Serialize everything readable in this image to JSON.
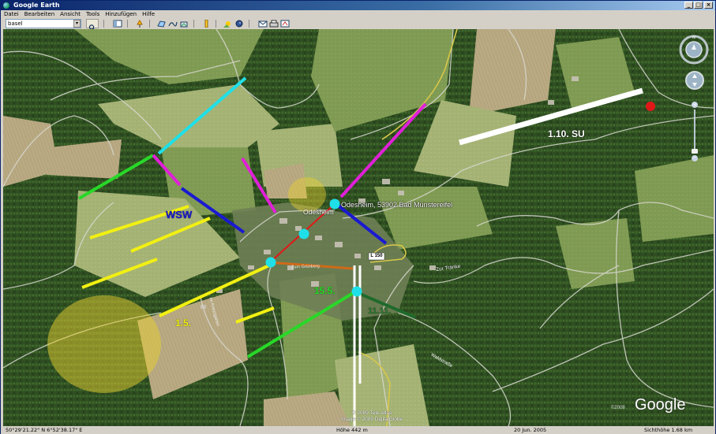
{
  "window": {
    "title": "Google Earth"
  },
  "menu": [
    "Datei",
    "Bearbeiten",
    "Ansicht",
    "Tools",
    "Hinzufügen",
    "Hilfe"
  ],
  "search": {
    "value": "basel"
  },
  "map": {
    "place_label": "Odesheim, 53902 Bad Münstereifel",
    "village_label": "Odesheim",
    "labels": {
      "wsw": "WSW",
      "su": "1.10. SU",
      "d15": "15.5.",
      "d111": "11.11.",
      "d1": "1.5."
    },
    "roads": {
      "r1": "Zum Grünberg",
      "r2": "Zur Tränke",
      "r3": "Im Kreuzgarten",
      "r4": "Waldstraße",
      "shield": "L 150"
    },
    "copyright": [
      "© 2009 Tele Atlas",
      "Image © 2009 DigitalGlobe"
    ],
    "brand": "Google",
    "brand_year": "©2008",
    "colors": {
      "cyan": "#1fe0e8",
      "magenta": "#e020d8",
      "blue": "#1a1ad0",
      "yellow": "#f2f012",
      "green": "#28d828",
      "darkgreen": "#1f6a2c",
      "white": "#ffffff",
      "orange": "#d06a18",
      "red": "#e01818"
    }
  },
  "status": {
    "coords": "50°29'21.22\" N    6°52'38.17\" E",
    "altitude": "Höhe 442 m",
    "date": "20 Jun. 2005",
    "eye": "Sichthöhe    1.68 km"
  }
}
